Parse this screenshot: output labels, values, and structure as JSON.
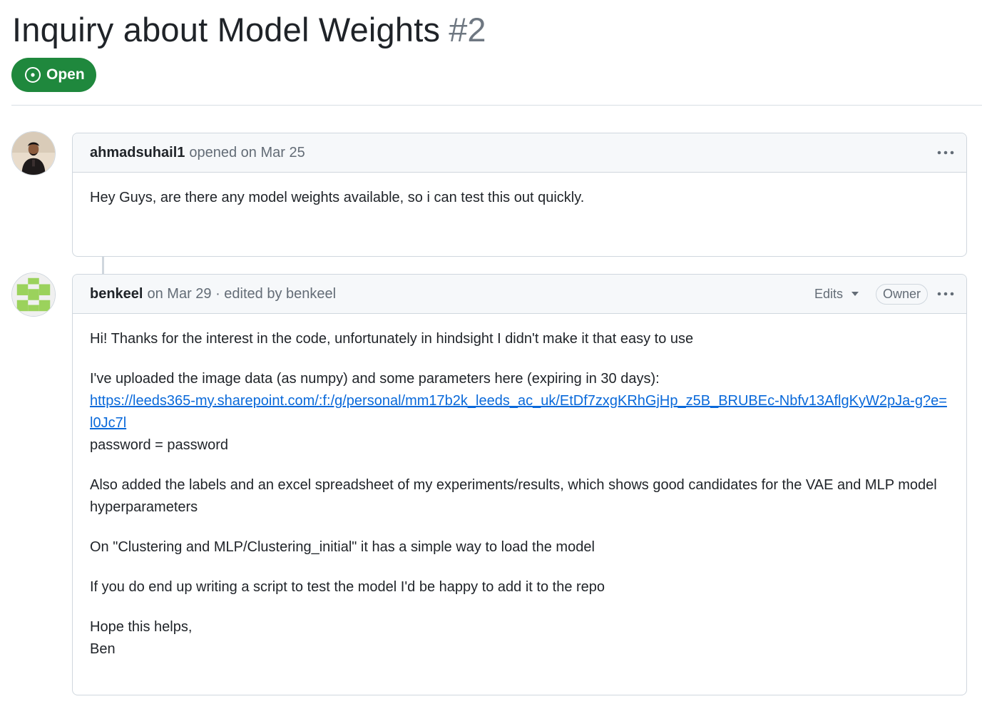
{
  "issue": {
    "title": "Inquiry about Model Weights",
    "number": "#2",
    "state": "Open",
    "state_color": "#1f883d"
  },
  "comments": [
    {
      "author": "ahmadsuhail1",
      "meta": "opened on Mar 25",
      "body": "Hey Guys, are there any model weights available, so i can test this out quickly."
    },
    {
      "author": "benkeel",
      "meta": "on Mar 29 · edited by benkeel",
      "edits_label": "Edits",
      "role_badge": "Owner",
      "intro": "Hi! Thanks for the interest in the code, unfortunately in hindsight I didn't make it that easy to use",
      "upload_text": "I've uploaded the image data (as numpy) and some parameters here (expiring in 30 days):",
      "link": "https://leeds365-my.sharepoint.com/:f:/g/personal/mm17b2k_leeds_ac_uk/EtDf7zxgKRhGjHp_z5B_BRUBEc-Nbfv13AflgKyW2pJa-g?e=l0Jc7l",
      "password_line": "password = password",
      "labels_text": "Also added the labels and an excel spreadsheet of my experiments/results, which shows good candidates for the VAE and MLP model hyperparameters",
      "clustering_text": "On \"Clustering and MLP/Clustering_initial\" it has a simple way to load the model",
      "script_text": "If you do end up writing a script to test the model I'd be happy to add it to the repo",
      "closing": "Hope this helps,",
      "signature": "Ben"
    }
  ],
  "icons": {
    "state": "issue-opened-icon",
    "menu": "kebab-horizontal-icon",
    "dropdown": "triangle-down-icon"
  }
}
